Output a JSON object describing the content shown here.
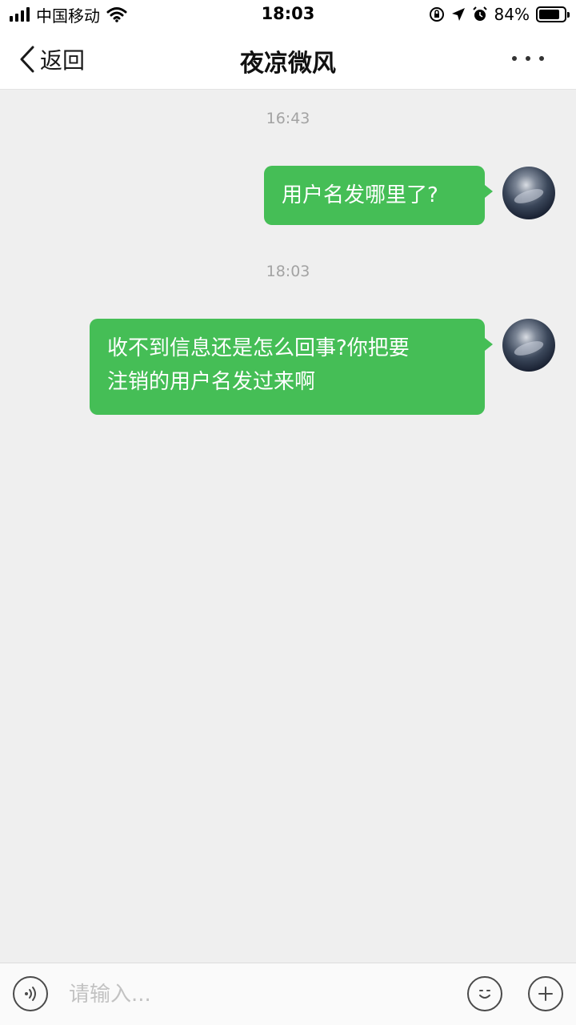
{
  "status_bar": {
    "carrier": "中国移动",
    "time": "18:03",
    "battery": "84%",
    "battery_level": 0.84
  },
  "nav": {
    "back_label": "返回",
    "title": "夜凉微风"
  },
  "messages": [
    {
      "timestamp": "16:43",
      "text": "用户名发哪里了?"
    },
    {
      "timestamp": "18:03",
      "text": "收不到信息还是怎么回事?你把要\n注销的用户名发过来啊"
    }
  ],
  "composer": {
    "placeholder": "请输入..."
  },
  "icons": {
    "back": "chevron-left-icon",
    "more": "more-dots-icon",
    "voice": "voice-icon",
    "emoji": "emoji-icon",
    "add": "plus-icon"
  },
  "colors": {
    "bubble": "#45be56",
    "background": "#efefef"
  }
}
